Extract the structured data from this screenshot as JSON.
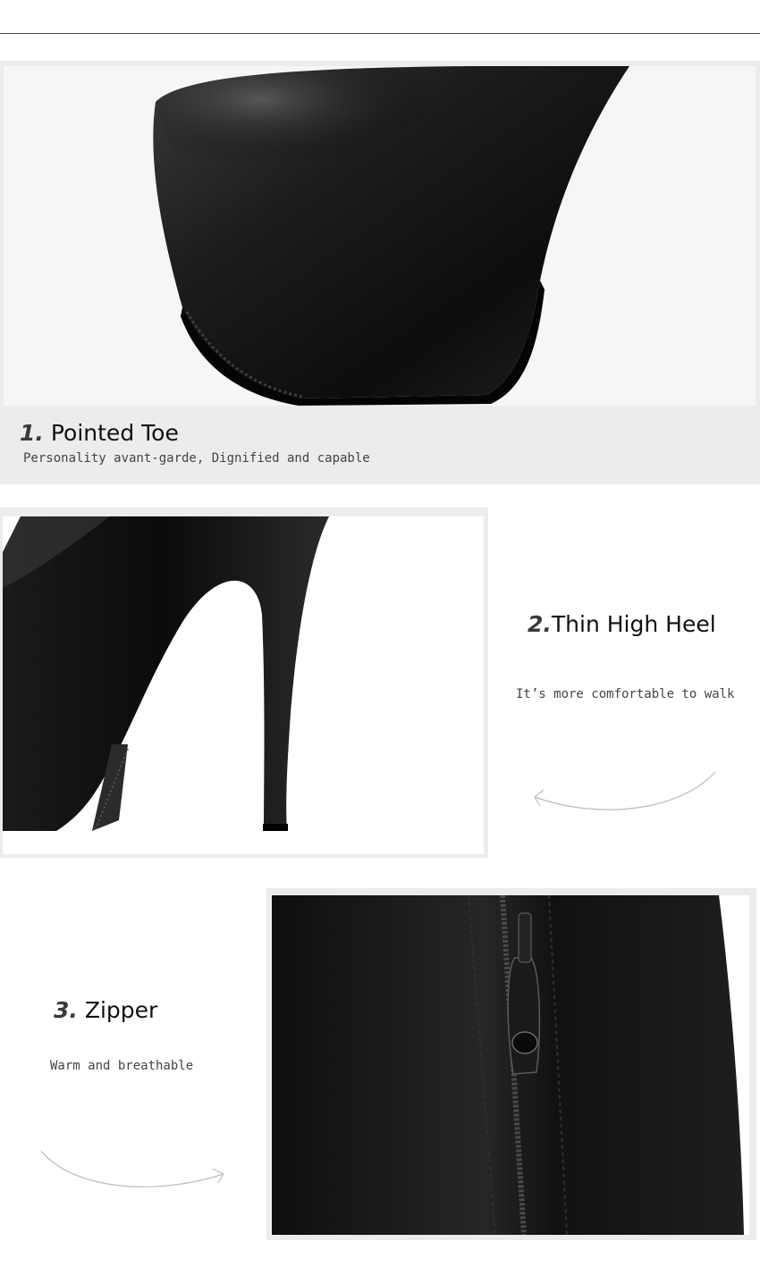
{
  "features": [
    {
      "number": "1.",
      "title": "Pointed Toe",
      "description": "Personality avant-garde, Dignified and capable"
    },
    {
      "number": "2.",
      "title": "Thin High Heel",
      "description": "It’s more comfortable to walk"
    },
    {
      "number": "3.",
      "title": "Zipper",
      "description": "Warm and breathable"
    }
  ],
  "colors": {
    "leather": "#141414",
    "panel": "#ececec",
    "text": "#111111"
  },
  "icons": [
    "curved-arrow-left-icon",
    "curved-arrow-right-icon"
  ]
}
